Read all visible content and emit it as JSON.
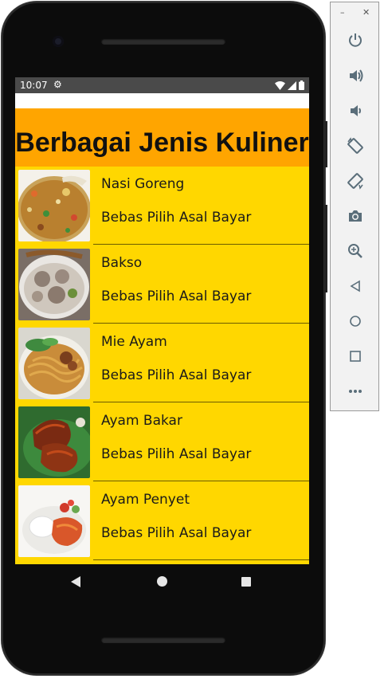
{
  "statusbar": {
    "time": "10:07"
  },
  "header": {
    "title": "Berbagai Jenis Kuliner"
  },
  "items": [
    {
      "title": "Nasi Goreng",
      "subtitle": "Bebas Pilih Asal Bayar",
      "image": "nasi-goreng-image"
    },
    {
      "title": "Bakso",
      "subtitle": "Bebas Pilih Asal Bayar",
      "image": "bakso-image"
    },
    {
      "title": "Mie Ayam",
      "subtitle": "Bebas Pilih Asal Bayar",
      "image": "mie-ayam-image"
    },
    {
      "title": "Ayam Bakar",
      "subtitle": "Bebas Pilih Asal Bayar",
      "image": "ayam-bakar-image"
    },
    {
      "title": "Ayam Penyet",
      "subtitle": "Bebas Pilih Asal Bayar",
      "image": "ayam-penyet-image"
    }
  ],
  "colors": {
    "header_bg": "#ffa500",
    "list_bg": "#ffd700",
    "statusbar_bg": "#4a4a4a"
  },
  "toolbar": {
    "icons": [
      "power-icon",
      "volume-up-icon",
      "volume-down-icon",
      "rotate-left-icon",
      "rotate-right-icon",
      "camera-icon",
      "zoom-icon",
      "back-icon",
      "home-icon",
      "overview-icon",
      "more-icon"
    ]
  }
}
